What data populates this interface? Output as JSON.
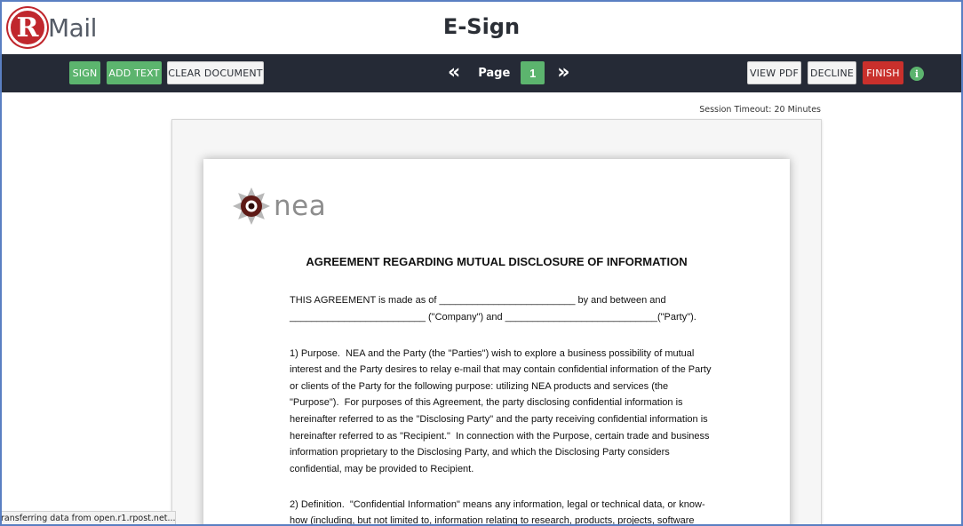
{
  "app": {
    "logo_letter": "R",
    "logo_text": "Mail",
    "page_title": "E-Sign"
  },
  "toolbar": {
    "sign_label": "SIGN",
    "add_text_label": "ADD TEXT",
    "clear_label": "CLEAR DOCUMENT",
    "page_label": "Page",
    "page_number": "1",
    "prev_icon": "«",
    "next_icon": "»",
    "view_pdf_label": "VIEW PDF",
    "decline_label": "DECLINE",
    "finish_label": "FINISH",
    "info_icon": "i"
  },
  "session": {
    "timeout_text": "Session Timeout: 20 Minutes"
  },
  "document": {
    "logo_text": "nea",
    "title": "AGREEMENT REGARDING MUTUAL DISCLOSURE OF INFORMATION",
    "lines": [
      "THIS AGREEMENT is made as of _________________________ by and between and",
      "_________________________ (\"Company\") and ____________________________(\"Party\").",
      "1) Purpose.  NEA and the Party (the \"Parties\") wish to explore a business possibility of mutual",
      "interest and the Party desires to relay e-mail that may contain confidential information of the Party",
      "or clients of the Party for the following purpose: utilizing NEA products and services (the",
      "\"Purpose\").  For purposes of this Agreement, the party disclosing confidential information is",
      "hereinafter referred to as the \"Disclosing Party\" and the party receiving confidential information is",
      "hereinafter referred to as \"Recipient.\"  In connection with the Purpose, certain trade and business",
      "information proprietary to the Disclosing Party, and which the Disclosing Party considers",
      "confidential, may be provided to Recipient.",
      "2) Definition.  \"Confidential Information\" means any information, legal or technical data, or know-",
      "how (including, but not limited to, information relating to research, products, projects, software"
    ]
  },
  "status_bar": {
    "text": "ransferring data from open.r1.rpost.net..."
  },
  "colors": {
    "toolbar_bg": "#252a36",
    "accent_green": "#5cb46e",
    "finish_red": "#c9302c",
    "brand_red": "#c0272d"
  }
}
